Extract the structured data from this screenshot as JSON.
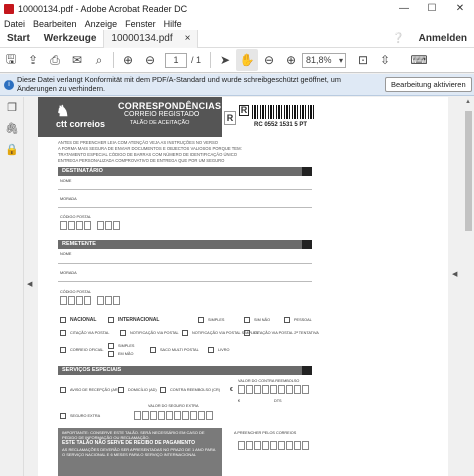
{
  "window": {
    "title": "10000134.pdf - Adobe Acrobat Reader DC",
    "minimize": "—",
    "maximize": "☐",
    "close": "✕"
  },
  "menu": [
    "Datei",
    "Bearbeiten",
    "Anzeige",
    "Fenster",
    "Hilfe"
  ],
  "tabs": {
    "start": "Start",
    "tools": "Werkzeuge",
    "document": "10000134.pdf",
    "doc_close": "×",
    "signin": "Anmelden"
  },
  "toolbar": {
    "page_current": "1",
    "page_total": "/ 1",
    "zoom": "81,8%"
  },
  "infobar": {
    "message": "Diese Datei verlangt Konformität mit dem PDF/A-Standard und wurde schreibgeschützt geöffnet, um Änderungen zu verhindern.",
    "button": "Bearbeitung aktivieren"
  },
  "icons": {
    "app": "acrobat-icon",
    "home": "home-icon",
    "save": "save-icon",
    "upload": "upload-icon",
    "print": "print-icon",
    "email": "mail-icon",
    "search": "search-icon",
    "prev": "arrow-up-icon",
    "next": "arrow-down-icon",
    "select": "cursor-icon",
    "hand": "hand-icon",
    "zoom_out": "zoom-out-icon",
    "zoom_in": "zoom-in-icon"
  },
  "document": {
    "brand": "ctt correios",
    "title": "CORRESPONDÊNCIAS",
    "subtitle": "CORREIO REGISTADO",
    "subtitle2": "TALÃO DE ACEITAÇÃO",
    "r_letter": "R",
    "tracking": "RC 0552 1531 5 PT",
    "intro1": "ANTES DE PREENCHER LEIA COM ATENÇÃO  VEJA AS INSTRUÇÕES NO VERSO",
    "intro2": "A FORMA MAIS SEGURA DE ENVIAR DOCUMENTOS E OBJECTOS VALIOSOS PORQUE TEM:",
    "intro3": "TRATAMENTO ESPECIAL          CÓDIGO DE BARRAS COM NÚMERO DE IDENTIFICAÇÃO ÚNICO",
    "intro4": "ENTREGA PERSONALIZADA        COMPROVATIVO DE ENTREGA QUE POR UM SEGURO",
    "sec_dest": "DESTINATÁRIO",
    "sec_rem": "REMETENTE",
    "sec_serv": "SERVIÇOS ESPECIAIS",
    "nome": "NOME",
    "morada": "MORADA",
    "cp": "CÓDIGO POSTAL",
    "nacional": "NACIONAL",
    "internacional": "INTERNACIONAL",
    "simples": "SIMPLES",
    "sim": "SIM NÃO",
    "pessoal": "PESSOAL",
    "citacao": "CITAÇÃO VIA POSTAL",
    "notif": "NOTIFICAÇÃO VIA POSTAL",
    "notif_s": "NOTIFICAÇÃO VIA POSTAL SIMPLES",
    "cit2": "CITAÇÃO VIA POSTAL 2ª TENTATIVA",
    "oficial": "CORREIO OFICIAL",
    "simples2": "SIMPLES",
    "emmao": "EM MÃO",
    "saco": "SACO MULTI POSTAL",
    "livro": "LIVRO",
    "aviso": "AVISO DE RECEPÇÃO (AR)",
    "domicilio": "DOMICÍLIO (AD)",
    "contra": "CONTRA REEMBOLSO (CR)",
    "valor_reemb": "VALOR DO CONTRA REEMBOLSO",
    "valor_seguro": "VALOR DO SEGURO EXTRA",
    "seguro": "SEGURO EXTRA",
    "euro": "€",
    "dts": "DTS",
    "imp1": "IMPORTANTE: CONSERVE ESTE TALÃO. SERÁ NECESSÁRIO EM CASO DE PEDIDO DE INFORMAÇÃO OU RECLAMAÇÃO.",
    "imp2": "ESTE TALÃO NÃO SERVE DE RECIBO DE PAGAMENTO",
    "imp3": "AS RECLAMAÇÕES DEVERÃO SER APRESENTADAS NO PRAZO DE 1 ANO PARA O SERVIÇO NACIONAL E 6 MESES PARA O SERVIÇO INTERNACIONAL",
    "stamp_label": "A PREENCHER PELOS CORREIOS"
  }
}
